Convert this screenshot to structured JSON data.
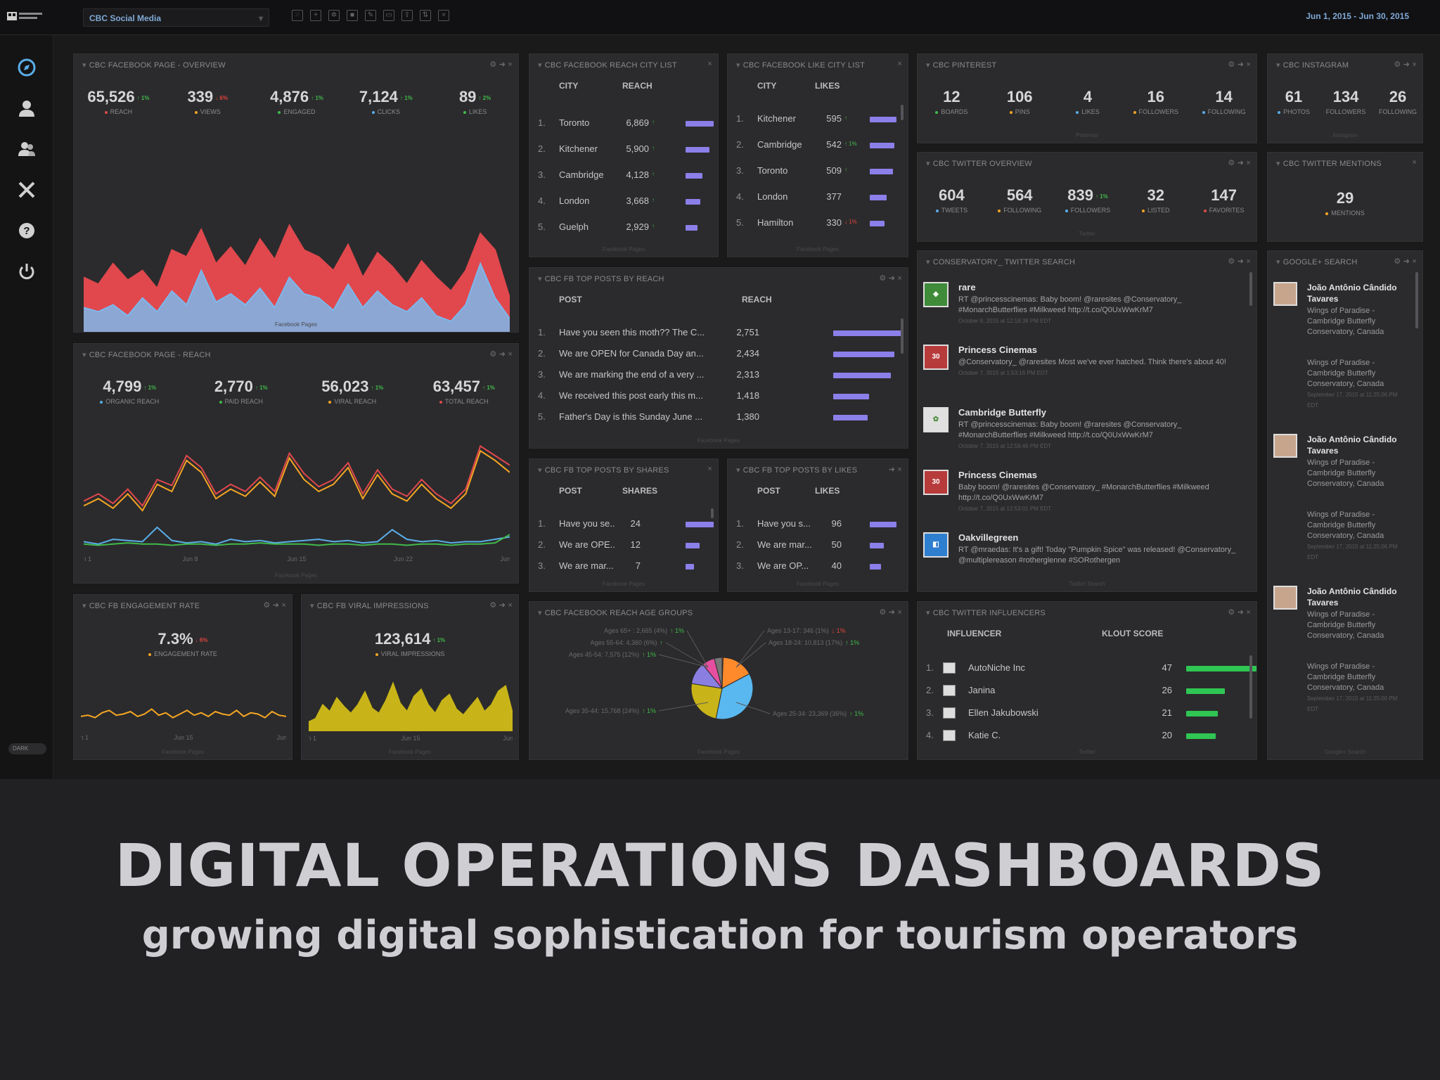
{
  "app": {
    "logo_text": "tourism WR",
    "dashboard": "CBC Social Media",
    "date_range": "Jun 1, 2015 - Jun 30, 2015",
    "dark_toggle": "DARK"
  },
  "nav": [
    {
      "icon": "compass-icon"
    },
    {
      "icon": "user-icon"
    },
    {
      "icon": "users-icon"
    },
    {
      "icon": "tools-icon"
    },
    {
      "icon": "help-icon"
    },
    {
      "icon": "power-icon"
    }
  ],
  "toolbar": [
    {
      "icon": "grid-icon",
      "glyph": "⁙"
    },
    {
      "icon": "plus-icon",
      "glyph": "+"
    },
    {
      "icon": "gear-icon",
      "glyph": "✲"
    },
    {
      "icon": "save-icon",
      "glyph": "■"
    },
    {
      "icon": "edit-icon",
      "glyph": "✎"
    },
    {
      "icon": "monitor-icon",
      "glyph": "▭"
    },
    {
      "icon": "share-icon",
      "glyph": "⇪"
    },
    {
      "icon": "sort-icon",
      "glyph": "⇅"
    },
    {
      "icon": "close-icon",
      "glyph": "×"
    }
  ],
  "fb_overview": {
    "title": "CBC Facebook Page - Overview",
    "metrics": [
      {
        "value": "65,526",
        "delta": "↑ 1%",
        "dir": "up",
        "label": "Reach",
        "dot": "#e04a4a"
      },
      {
        "value": "339",
        "delta": "↓ 6%",
        "dir": "dn",
        "label": "Views",
        "dot": "#f5a623"
      },
      {
        "value": "4,876",
        "delta": "↑ 1%",
        "dir": "up",
        "label": "Engaged",
        "dot": "#41b94a"
      },
      {
        "value": "7,124",
        "delta": "↑ 1%",
        "dir": "up",
        "label": "Clicks",
        "dot": "#5aaee8"
      },
      {
        "value": "89",
        "delta": "↑ 2%",
        "dir": "up",
        "label": "Likes",
        "dot": "#41b94a"
      }
    ],
    "x_ticks": [
      "Jun 1",
      "Jun 8",
      "Jun 15",
      "Jun 22",
      "Jun 29"
    ],
    "footer": "Facebook Pages"
  },
  "fb_reach": {
    "title": "CBC Facebook Page - Reach",
    "metrics": [
      {
        "value": "4,799",
        "delta": "↑ 1%",
        "dir": "up",
        "label": "Organic Reach",
        "dot": "#5aaee8"
      },
      {
        "value": "2,770",
        "delta": "↑ 1%",
        "dir": "up",
        "label": "Paid Reach",
        "dot": "#41b94a"
      },
      {
        "value": "56,023",
        "delta": "↑ 1%",
        "dir": "up",
        "label": "Viral Reach",
        "dot": "#f5a623"
      },
      {
        "value": "63,457",
        "delta": "↑ 1%",
        "dir": "up",
        "label": "Total Reach",
        "dot": "#e04a4a"
      }
    ],
    "x_ticks": [
      "Jun 1",
      "Jun 8",
      "Jun 15",
      "Jun 22",
      "Jun 29"
    ],
    "footer": "Facebook Pages"
  },
  "engagement": {
    "title": "CBC FB Engagement Rate",
    "value": "7.3%",
    "delta": "↓ 6%",
    "label": "Engagement Rate",
    "x_ticks": [
      "Jun 1",
      "Jun 15",
      "Jun 29"
    ],
    "footer": "Facebook Pages"
  },
  "viral": {
    "title": "CBC FB Viral Impressions",
    "value": "123,614",
    "delta": "↑ 1%",
    "label": "Viral Impressions",
    "x_ticks": [
      "Jun 1",
      "Jun 15",
      "Jun 29"
    ],
    "footer": "Facebook Pages"
  },
  "reach_city": {
    "title": "CBC Facebook Reach City List",
    "col1": "City",
    "col2": "Reach",
    "rows": [
      {
        "n": "1.",
        "name": "Toronto",
        "val": "6,869",
        "chg": "↑",
        "dir": "up",
        "bar": 1.0
      },
      {
        "n": "2.",
        "name": "Kitchener",
        "val": "5,900",
        "chg": "↑",
        "dir": "up",
        "bar": 0.86
      },
      {
        "n": "3.",
        "name": "Cambridge",
        "val": "4,128",
        "chg": "↑",
        "dir": "up",
        "bar": 0.6
      },
      {
        "n": "4.",
        "name": "London",
        "val": "3,668",
        "chg": "↑",
        "dir": "up",
        "bar": 0.53
      },
      {
        "n": "5.",
        "name": "Guelph",
        "val": "2,929",
        "chg": "↑",
        "dir": "up",
        "bar": 0.43
      }
    ],
    "footer": "Facebook Pages"
  },
  "like_city": {
    "title": "CBC Facebook Like City List",
    "col1": "City",
    "col2": "Likes",
    "rows": [
      {
        "n": "1.",
        "name": "Kitchener",
        "val": "595",
        "chg": "↑",
        "dir": "up",
        "bar": 1.0
      },
      {
        "n": "2.",
        "name": "Cambridge",
        "val": "542",
        "chg": "↑ 1%",
        "dir": "up",
        "bar": 0.91
      },
      {
        "n": "3.",
        "name": "Toronto",
        "val": "509",
        "chg": "↑",
        "dir": "up",
        "bar": 0.86
      },
      {
        "n": "4.",
        "name": "London",
        "val": "377",
        "chg": "",
        "dir": "up",
        "bar": 0.63
      },
      {
        "n": "5.",
        "name": "Hamilton",
        "val": "330",
        "chg": "↓ 1%",
        "dir": "dn",
        "bar": 0.55
      }
    ],
    "footer": "Facebook Pages"
  },
  "top_reach": {
    "title": "CBC FB Top Posts by Reach",
    "col1": "Post",
    "col2": "Reach",
    "rows": [
      {
        "n": "1.",
        "name": "Have you seen this moth?? The C...",
        "val": "2,751",
        "bar": 1.0
      },
      {
        "n": "2.",
        "name": "We are OPEN for Canada Day an...",
        "val": "2,434",
        "bar": 0.89
      },
      {
        "n": "3.",
        "name": "We are marking the end of a very ...",
        "val": "2,313",
        "bar": 0.84
      },
      {
        "n": "4.",
        "name": "We received this post early this m...",
        "val": "1,418",
        "bar": 0.52
      },
      {
        "n": "5.",
        "name": "Father's Day is this Sunday June ...",
        "val": "1,380",
        "bar": 0.5
      }
    ],
    "footer": "Facebook Pages"
  },
  "top_shares": {
    "title": "CBC FB Top Posts by Shares",
    "col1": "Post",
    "col2": "Shares",
    "rows": [
      {
        "n": "1.",
        "name": "Have you se...",
        "val": "24",
        "bar": 1.0
      },
      {
        "n": "2.",
        "name": "We are OPE...",
        "val": "12",
        "bar": 0.5
      },
      {
        "n": "3.",
        "name": "We are mar...",
        "val": "7",
        "bar": 0.29
      }
    ],
    "footer": "Facebook Pages"
  },
  "top_likes": {
    "title": "CBC FB Top Posts by Likes",
    "col1": "Post",
    "col2": "Likes",
    "rows": [
      {
        "n": "1.",
        "name": "Have you s...",
        "val": "96",
        "bar": 1.0
      },
      {
        "n": "2.",
        "name": "We are mar...",
        "val": "50",
        "bar": 0.52
      },
      {
        "n": "3.",
        "name": "We are OP...",
        "val": "40",
        "bar": 0.42
      }
    ],
    "footer": "Facebook Pages"
  },
  "age_groups": {
    "title": "CBC Facebook Reach Age Groups",
    "labels": [
      {
        "text": "Ages 65+ : 2,665 (4%)",
        "chg": "↑ 1%"
      },
      {
        "text": "Ages 55-64: 4,360 (6%)",
        "chg": "↑"
      },
      {
        "text": "Ages 45-54: 7,575 (12%)",
        "chg": "↑ 1%"
      },
      {
        "text": "Ages 35-44: 15,768 (24%)",
        "chg": "↑ 1%"
      },
      {
        "text": "Ages 13-17: 346 (1%)",
        "chg": "↓ 1%"
      },
      {
        "text": "Ages 18-24: 10,813 (17%)",
        "chg": "↑ 1%"
      },
      {
        "text": "Ages 25-34: 23,369 (36%)",
        "chg": "↑ 1%"
      }
    ],
    "footer": "Facebook Pages"
  },
  "pinterest": {
    "title": "CBC Pinterest",
    "metrics": [
      {
        "value": "12",
        "label": "Boards",
        "dot": "#41b94a"
      },
      {
        "value": "106",
        "label": "Pins",
        "dot": "#f5a623"
      },
      {
        "value": "4",
        "label": "Likes",
        "dot": "#5aaee8"
      },
      {
        "value": "16",
        "label": "Followers",
        "dot": "#f5a623"
      },
      {
        "value": "14",
        "label": "Following",
        "dot": "#5aaee8"
      }
    ],
    "footer": "Pinterest"
  },
  "instagram": {
    "title": "CBC Instagram",
    "metrics": [
      {
        "value": "61",
        "label": "Photos",
        "dot": "#5aaee8"
      },
      {
        "value": "134",
        "label": "Followers",
        "dot": ""
      },
      {
        "value": "26",
        "label": "Following",
        "dot": ""
      }
    ],
    "footer": "Instagram"
  },
  "twitter": {
    "title": "CBC Twitter Overview",
    "metrics": [
      {
        "value": "604",
        "label": "Tweets",
        "dot": "#5aaee8"
      },
      {
        "value": "564",
        "label": "Following",
        "dot": "#f5a623"
      },
      {
        "value": "839",
        "delta": "↑ 1%",
        "label": "Followers",
        "dot": "#5aaee8"
      },
      {
        "value": "32",
        "label": "Listed",
        "dot": "#f5a623"
      },
      {
        "value": "147",
        "label": "Favorites",
        "dot": "#e04a4a"
      }
    ],
    "footer": "Twitter"
  },
  "mentions": {
    "title": "CBC Twitter Mentions",
    "value": "29",
    "label": "Mentions"
  },
  "search": {
    "title": "Conservatory_ Twitter Search",
    "items": [
      {
        "name": "rare",
        "avatar": "◈",
        "text": "RT @princesscinemas: Baby boom! @raresites @Conservatory_ #MonarchButterflies #Milkweed http://t.co/Q0UxWwKrM7",
        "ts": "October 8, 2015 at 12:18:38 PM EDT"
      },
      {
        "name": "Princess Cinemas",
        "avatar": "30",
        "text": "@Conservatory_ @raresites Most we've ever hatched. Think there's about 40!",
        "ts": "October 7, 2015 at 1:53:16 PM EDT"
      },
      {
        "name": "Cambridge Butterfly",
        "avatar": "✿",
        "text": "RT @princesscinemas: Baby boom! @raresites @Conservatory_ #MonarchButterflies #Milkweed http://t.co/Q0UxWwKrM7",
        "ts": "October 7, 2015 at 12:59:46 PM EDT"
      },
      {
        "name": "Princess Cinemas",
        "avatar": "30",
        "text": "Baby boom! @raresites @Conservatory_ #MonarchButterflies #Milkweed http://t.co/Q0UxWwKrM7",
        "ts": "October 7, 2015 at 12:53:01 PM EDT"
      },
      {
        "name": "Oakvillegreen",
        "avatar": "◧",
        "text": "RT @mraedas: It's a gift! Today \"Pumpkin Spice\" was released! @Conservatory_ @multiplereason #rotherglenne #SORothergen",
        "ts": ""
      }
    ],
    "footer": "Twitter Search"
  },
  "google": {
    "title": "Google+ Search",
    "items": [
      {
        "name": "João Antônio Cândido Tavares",
        "text": "Wings of Paradise - Cambridge Butterfly Conservatory, Canada"
      },
      {
        "text": "Wings of Paradise - Cambridge Butterfly Conservatory, Canada",
        "ts": "September 17, 2015 at 11:25:06 PM EDT"
      },
      {
        "name": "João Antônio Cândido Tavares",
        "text": "Wings of Paradise - Cambridge Butterfly Conservatory, Canada"
      },
      {
        "text": "Wings of Paradise - Cambridge Butterfly Conservatory, Canada",
        "ts": "September 17, 2015 at 11:25:06 PM EDT"
      },
      {
        "name": "João Antônio Cândido Tavares",
        "text": "Wings of Paradise - Cambridge Butterfly Conservatory, Canada"
      },
      {
        "text": "Wings of Paradise - Cambridge Butterfly Conservatory, Canada",
        "ts": "September 17, 2015 at 11:25:00 PM EDT"
      }
    ],
    "footer": "Google+ Search"
  },
  "influencers": {
    "title": "CBC Twitter Influencers",
    "col1": "Influencer",
    "col2": "Klout Score",
    "rows": [
      {
        "n": "1.",
        "name": "AutoNiche Inc",
        "val": "47",
        "bar": 1.0
      },
      {
        "n": "2.",
        "name": "Janina",
        "val": "26",
        "bar": 0.55
      },
      {
        "n": "3.",
        "name": "Ellen Jakubowski",
        "val": "21",
        "bar": 0.45
      },
      {
        "n": "4.",
        "name": "Katie C.",
        "val": "20",
        "bar": 0.42
      }
    ],
    "footer": "Twitter"
  },
  "slide": {
    "title": "DIGITAL OPERATIONS DASHBOARDS",
    "subtitle": "growing digital sophistication for tourism operators"
  },
  "chart_data": [
    {
      "type": "area",
      "title": "CBC Facebook Page - Overview",
      "x": [
        "Jun 1",
        "Jun 2",
        "Jun 3",
        "Jun 4",
        "Jun 5",
        "Jun 6",
        "Jun 7",
        "Jun 8",
        "Jun 9",
        "Jun 10",
        "Jun 11",
        "Jun 12",
        "Jun 13",
        "Jun 14",
        "Jun 15",
        "Jun 16",
        "Jun 17",
        "Jun 18",
        "Jun 19",
        "Jun 20",
        "Jun 21",
        "Jun 22",
        "Jun 23",
        "Jun 24",
        "Jun 25",
        "Jun 26",
        "Jun 27",
        "Jun 28",
        "Jun 29",
        "Jun 30"
      ],
      "series": [
        {
          "name": "Reach",
          "color": "#e0484d",
          "values": [
            50,
            45,
            60,
            48,
            55,
            42,
            70,
            65,
            85,
            60,
            72,
            58,
            78,
            63,
            88,
            70,
            65,
            55,
            74,
            50,
            68,
            58,
            45,
            62,
            50,
            40,
            55,
            82,
            70,
            35
          ]
        },
        {
          "name": "Engaged",
          "color": "#7cb8ec",
          "values": [
            28,
            25,
            30,
            22,
            35,
            25,
            40,
            30,
            55,
            32,
            38,
            30,
            42,
            28,
            50,
            38,
            35,
            26,
            45,
            28,
            40,
            30,
            25,
            35,
            22,
            18,
            30,
            60,
            35,
            20
          ]
        }
      ]
    },
    {
      "type": "line",
      "title": "CBC Facebook Page - Reach",
      "x": [
        "Jun 1",
        "Jun 2",
        "Jun 3",
        "Jun 4",
        "Jun 5",
        "Jun 6",
        "Jun 7",
        "Jun 8",
        "Jun 9",
        "Jun 10",
        "Jun 11",
        "Jun 12",
        "Jun 13",
        "Jun 14",
        "Jun 15",
        "Jun 16",
        "Jun 17",
        "Jun 18",
        "Jun 19",
        "Jun 20",
        "Jun 21",
        "Jun 22",
        "Jun 23",
        "Jun 24",
        "Jun 25",
        "Jun 26",
        "Jun 27",
        "Jun 28",
        "Jun 29",
        "Jun 30"
      ],
      "series": [
        {
          "name": "Total Reach",
          "color": "#e0484d",
          "values": [
            42,
            48,
            40,
            52,
            38,
            60,
            55,
            80,
            70,
            48,
            56,
            50,
            62,
            50,
            82,
            65,
            54,
            60,
            74,
            48,
            68,
            52,
            46,
            60,
            48,
            40,
            52,
            88,
            80,
            72
          ]
        },
        {
          "name": "Viral Reach",
          "color": "#f5a623",
          "values": [
            38,
            44,
            36,
            48,
            34,
            56,
            50,
            76,
            66,
            44,
            52,
            46,
            58,
            46,
            78,
            60,
            50,
            56,
            70,
            44,
            64,
            48,
            42,
            56,
            44,
            36,
            48,
            84,
            76,
            66
          ]
        },
        {
          "name": "Organic Reach",
          "color": "#5aaee8",
          "values": [
            8,
            6,
            10,
            9,
            8,
            20,
            9,
            7,
            8,
            6,
            10,
            8,
            9,
            7,
            8,
            9,
            10,
            8,
            9,
            7,
            8,
            18,
            10,
            8,
            9,
            7,
            8,
            8,
            10,
            12
          ]
        },
        {
          "name": "Paid Reach",
          "color": "#41b94a",
          "values": [
            6,
            5,
            6,
            7,
            6,
            6,
            5,
            6,
            6,
            5,
            6,
            6,
            7,
            6,
            6,
            6,
            5,
            6,
            6,
            5,
            6,
            6,
            5,
            6,
            6,
            5,
            6,
            6,
            7,
            14
          ]
        }
      ]
    },
    {
      "type": "line",
      "title": "CBC FB Engagement Rate",
      "x": [
        "Jun 1",
        "Jun 15",
        "Jun 29"
      ],
      "series": [
        {
          "name": "Engagement Rate",
          "color": "#f5a623",
          "values": [
            7.1,
            7.2,
            7.0,
            7.4,
            7.6,
            7.2,
            7.3,
            7.5,
            7.1,
            7.3,
            7.7,
            7.2,
            7.4,
            7.0,
            7.3,
            7.6,
            7.2,
            7.4,
            7.1,
            7.5,
            7.3,
            7.2,
            7.6,
            7.1,
            7.4,
            7.3,
            7.0,
            7.5,
            7.2,
            7.1
          ]
        }
      ]
    },
    {
      "type": "area",
      "title": "CBC FB Viral Impressions",
      "x": [
        "Jun 1",
        "Jun 15",
        "Jun 29"
      ],
      "series": [
        {
          "name": "Viral Impressions",
          "color": "#c8b418",
          "values": [
            10,
            14,
            30,
            22,
            38,
            28,
            20,
            30,
            45,
            26,
            20,
            35,
            55,
            32,
            22,
            40,
            48,
            30,
            20,
            35,
            42,
            25,
            18,
            28,
            38,
            22,
            30,
            46,
            52,
            20
          ]
        }
      ]
    },
    {
      "type": "pie",
      "title": "CBC Facebook Reach Age Groups",
      "categories": [
        "Ages 13-17",
        "Ages 18-24",
        "Ages 25-34",
        "Ages 35-44",
        "Ages 45-54",
        "Ages 55-64",
        "Ages 65+"
      ],
      "values": [
        346,
        10813,
        23369,
        15768,
        7575,
        4360,
        2665
      ],
      "colors": [
        "#e04a4a",
        "#ff8a2b",
        "#5ab8f0",
        "#c8b418",
        "#8a7fe0",
        "#e64fa0",
        "#777777"
      ]
    }
  ]
}
